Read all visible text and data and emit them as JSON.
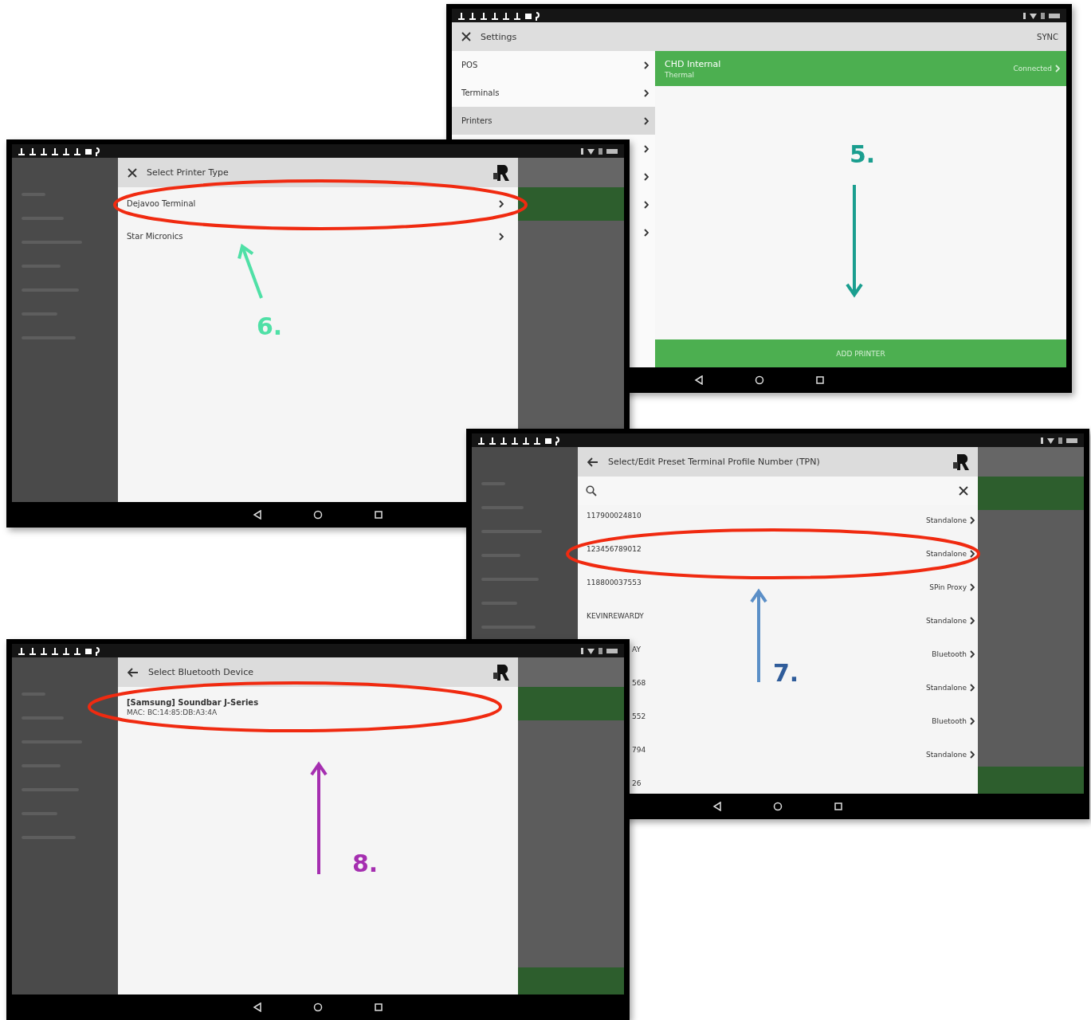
{
  "screens": [
    {
      "kind": "settings",
      "title": "Settings",
      "action": "SYNC",
      "sidebar": [
        {
          "label": "POS",
          "selected": false
        },
        {
          "label": "Terminals",
          "selected": false
        },
        {
          "label": "Printers",
          "selected": true
        },
        {
          "selected": false
        },
        {
          "selected": false
        },
        {
          "selected": false
        },
        {
          "selected": false
        }
      ],
      "printers": [
        {
          "name": "CHD Internal",
          "type": "Thermal",
          "status": "Connected"
        }
      ],
      "button": "ADD PRINTER"
    },
    {
      "kind": "picker",
      "back_button": false,
      "title": "Select Printer Type",
      "rows": [
        {
          "label": "Dejavoo Terminal"
        },
        {
          "label": "Star Micronics"
        }
      ]
    },
    {
      "kind": "tpn",
      "back_button": true,
      "title": "Select/Edit Preset Terminal Profile Number (TPN)",
      "rows": [
        {
          "kind": "full",
          "label": "117900024810",
          "mode": "Standalone"
        },
        {
          "kind": "full",
          "label": "123456789012",
          "mode": "Standalone"
        },
        {
          "kind": "full",
          "label": "118800037553",
          "mode": "SPin Proxy"
        },
        {
          "kind": "full",
          "label": "KEVINREWARDY",
          "mode": "Standalone"
        },
        {
          "kind": "cut",
          "label": "AY",
          "mode": "Bluetooth"
        },
        {
          "kind": "cut",
          "label": "568",
          "mode": "Standalone"
        },
        {
          "kind": "cut",
          "label": "552",
          "mode": "Bluetooth"
        },
        {
          "kind": "cut",
          "label": "794",
          "mode": "Standalone"
        },
        {
          "kind": "cut",
          "label": "26"
        }
      ]
    },
    {
      "kind": "bluetooth",
      "back_button": true,
      "title": "Select Bluetooth Device",
      "devices": [
        {
          "name": "[Samsung] Soundbar J-Series",
          "mac": "MAC: BC:14:85:DB:A3:4A"
        }
      ]
    }
  ],
  "annotations": [
    {
      "label": "5.",
      "color": "#1a9e8f"
    },
    {
      "label": "6.",
      "color": "#4fe0a6"
    },
    {
      "label": "7.",
      "color": "#2f5c9a"
    },
    {
      "label": "8.",
      "color": "#a52fb0"
    }
  ]
}
